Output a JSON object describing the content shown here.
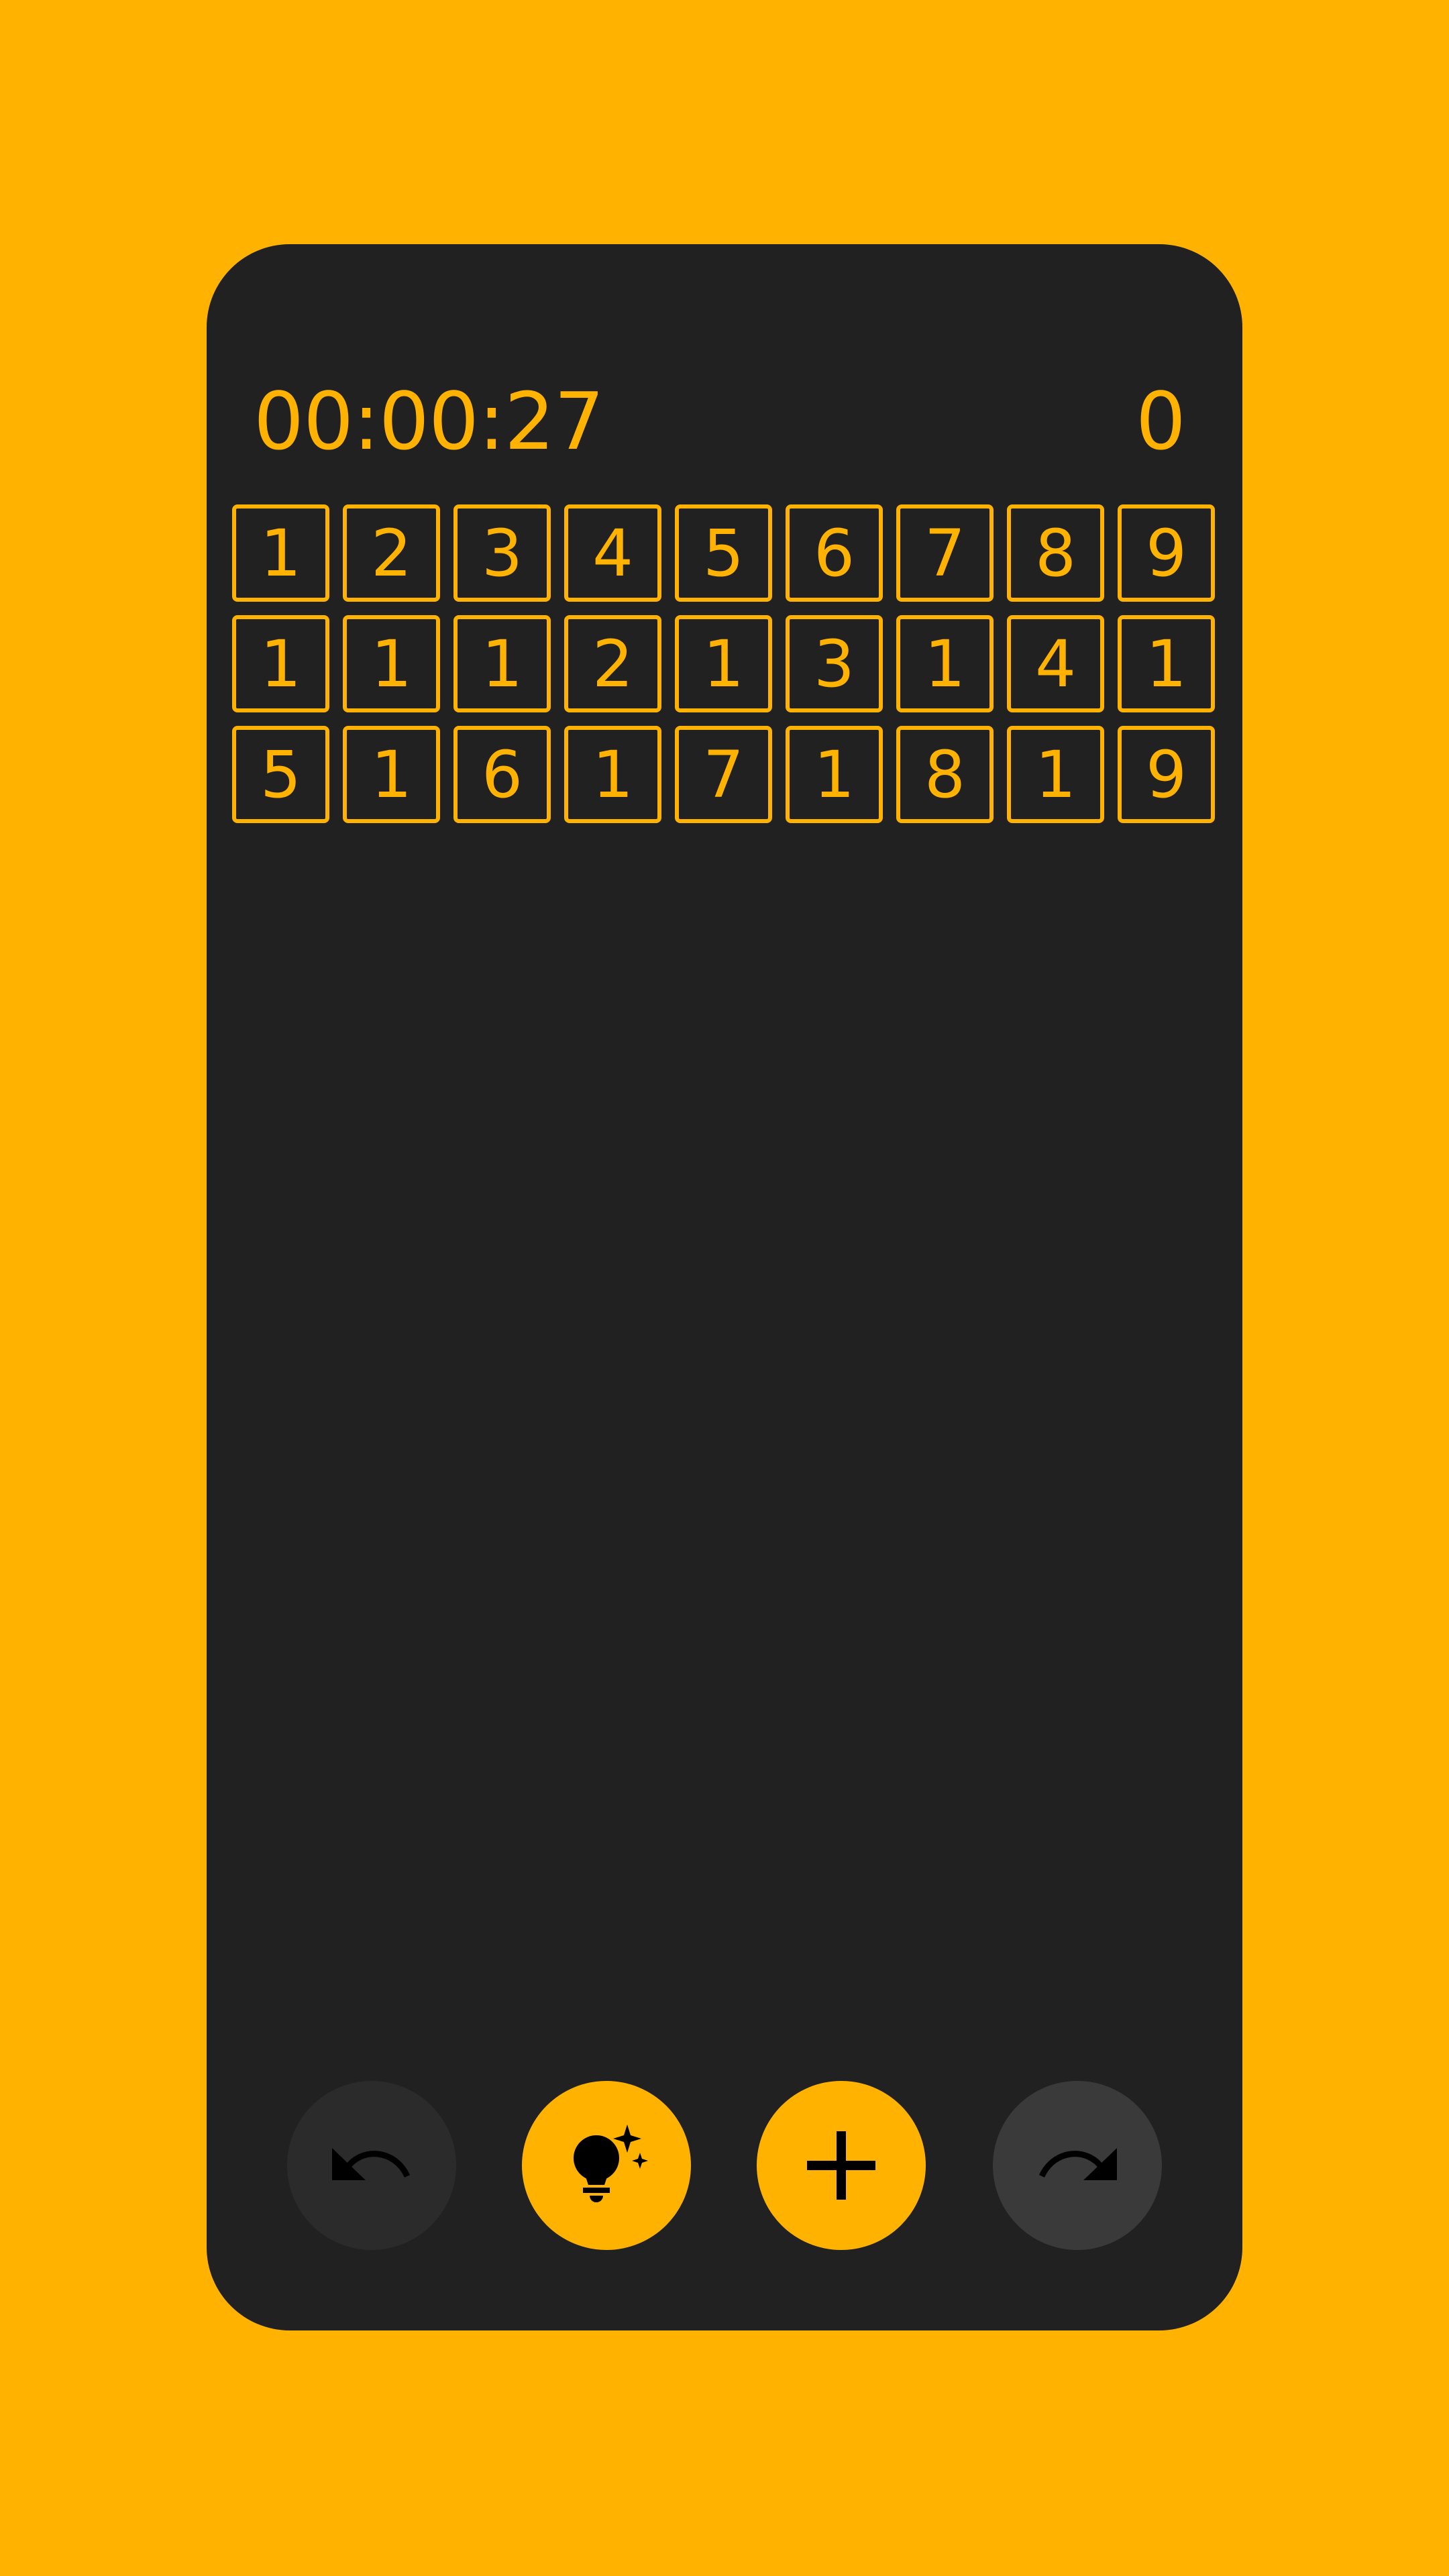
{
  "colors": {
    "background": "#FFB300",
    "panel": "#212121",
    "accent": "#FFB300",
    "undo_button_bg": "#2B2B2B",
    "redo_button_bg": "#3A3A3A"
  },
  "status": {
    "timer": "00:00:27",
    "score": "0"
  },
  "board": {
    "cells": [
      "1",
      "2",
      "3",
      "4",
      "5",
      "6",
      "7",
      "8",
      "9",
      "1",
      "1",
      "1",
      "2",
      "1",
      "3",
      "1",
      "4",
      "1",
      "5",
      "1",
      "6",
      "1",
      "7",
      "1",
      "8",
      "1",
      "9"
    ]
  },
  "controls": {
    "undo": {
      "icon": "undo-icon",
      "enabled": false
    },
    "hint": {
      "icon": "lightbulb-sparkle-icon",
      "enabled": true
    },
    "add": {
      "icon": "plus-icon",
      "enabled": true
    },
    "redo": {
      "icon": "redo-icon",
      "enabled": false
    }
  }
}
